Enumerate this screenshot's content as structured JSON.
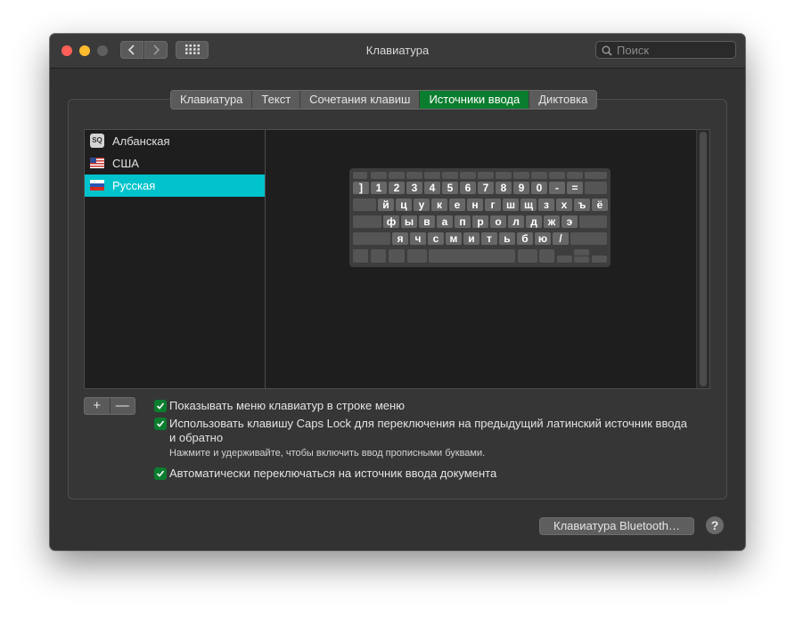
{
  "window": {
    "title": "Клавиатура"
  },
  "search": {
    "placeholder": "Поиск"
  },
  "tabs": [
    {
      "label": "Клавиатура"
    },
    {
      "label": "Текст"
    },
    {
      "label": "Сочетания клавиш"
    },
    {
      "label": "Источники ввода",
      "active": true
    },
    {
      "label": "Диктовка"
    }
  ],
  "input_sources": [
    {
      "label": "Албанская",
      "badge": "SQ"
    },
    {
      "label": "США"
    },
    {
      "label": "Русская",
      "selected": true
    }
  ],
  "keyboard": {
    "row1": [
      "]",
      "1",
      "2",
      "3",
      "4",
      "5",
      "6",
      "7",
      "8",
      "9",
      "0",
      "-",
      "="
    ],
    "row2": [
      "й",
      "ц",
      "у",
      "к",
      "е",
      "н",
      "г",
      "ш",
      "щ",
      "з",
      "х",
      "ъ",
      "ё"
    ],
    "row3": [
      "ф",
      "ы",
      "в",
      "а",
      "п",
      "р",
      "о",
      "л",
      "д",
      "ж",
      "э"
    ],
    "row4": [
      "я",
      "ч",
      "с",
      "м",
      "и",
      "т",
      "ь",
      "б",
      "ю",
      "/"
    ]
  },
  "list_controls": {
    "add": "+",
    "remove": "—"
  },
  "options": {
    "show_menu": "Показывать меню клавиатур в строке меню",
    "caps_lock_line1": "Использовать клавишу Caps Lock для переключения на предыдущий латинский источник ввода",
    "caps_lock_line2": "и обратно",
    "caps_lock_hint": "Нажмите и удерживайте, чтобы включить ввод прописными буквами.",
    "auto_switch": "Автоматически переключаться на источник ввода документа"
  },
  "buttons": {
    "bluetooth": "Клавиатура Bluetooth…",
    "help": "?"
  },
  "colors": {
    "accent": "#0b7d2e",
    "selection": "#00c3cc"
  }
}
